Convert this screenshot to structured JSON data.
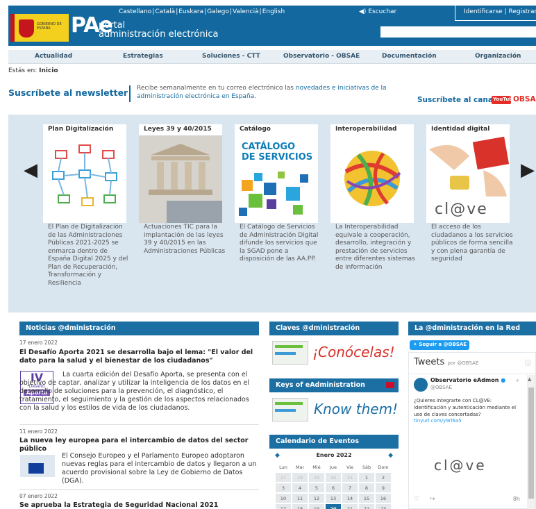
{
  "header": {
    "gov_label": "GOBIERNO DE ESPAÑA",
    "logo_pae": "PAe",
    "logo_line1": "portal",
    "logo_line2": "administración electrónica",
    "languages": [
      "Castellano",
      "Català",
      "Euskara",
      "Galego",
      "Valencià",
      "English"
    ],
    "listen": "Escuchar",
    "identify": "Identificarse",
    "register": "Registrarse",
    "search_placeholder": ""
  },
  "nav": [
    "Actualidad",
    "Estrategias",
    "Soluciones - CTT",
    "Observatorio - OBSAE",
    "Documentación",
    "Organización"
  ],
  "breadcrumb": {
    "prefix": "Estás en:",
    "current": "Inicio"
  },
  "newsletter": {
    "title": "Suscríbete al newsletter",
    "text_before": "Recibe semanalmente en tu correo electrónico las ",
    "text_link": "novedades e iniciativas de la administración electrónica en España",
    "text_after": ".",
    "channel": "Suscríbete al canal",
    "youtube": "YouTube",
    "obsae": "OBSAE"
  },
  "carousel": [
    {
      "title": "Plan Digitalización",
      "text": "El Plan de Digitalización de las Administraciones Públicas 2021-2025 se enmarca dentro de España Digital 2025 y del Plan de Recuperación, Transformación y Resiliencia"
    },
    {
      "title": "Leyes 39 y 40/2015",
      "text": "Actuaciones TIC para la implantación de las leyes 39 y 40/2015 en las Administraciones Públicas"
    },
    {
      "title": "Catálogo",
      "text": "El Catálogo de Servicios de Administración Digital difunde los servicios que la SGAD pone a disposición de las AA.PP.",
      "img_text1": "CATÁLOGO",
      "img_text2": "DE SERVICIOS"
    },
    {
      "title": "Interoperabilidad",
      "text": "La Interoperabilidad equivale a cooperación, desarrollo, integración y prestación de servicios entre diferentes sistemas de información"
    },
    {
      "title": "Identidad digital",
      "text": "El acceso de los ciudadanos a los servicios públicos de forma sencilla y con plena garantía de seguridad",
      "img_text": "cl@ve"
    }
  ],
  "news": {
    "header": "Noticias @dministración",
    "items": [
      {
        "date": "17 enero 2022",
        "title": "El Desafío Aporta 2021 se desarrolla bajo el lema: \"El valor del dato para la salud y el bienestar de los ciudadanos\"",
        "body": "La cuarta edición del Desafío Aporta, se presenta con el objetivo de captar, analizar y utilizar la inteligencia de los datos en el desarrollo de soluciones para la prevención, el diagnóstico, el tratamiento, el seguimiento y la gestión de los aspectos relacionados con la salud y los estilos de vida de los ciudadanos.",
        "thumb1": "IV",
        "thumb2": "Desafío",
        "thumb3": "Aporta"
      },
      {
        "date": "11 enero 2022",
        "title": "La nueva ley europea para el intercambio de datos del sector público",
        "body": "El Consejo Europeo y el Parlamento Europeo adoptaron nuevas reglas para el intercambio de datos y llegaron a un acuerdo provisional sobre la Ley de Gobierno de Datos (DGA)."
      },
      {
        "date": "07 enero 2022",
        "title": "Se aprueba la Estrategia de Seguridad Nacional 2021"
      }
    ]
  },
  "claves": {
    "header": "Claves @dministración",
    "banner": "¡Conócelas!"
  },
  "keys": {
    "header": "Keys of eAdministration",
    "banner": "Know them!"
  },
  "calendar": {
    "header": "Calendario de Eventos",
    "month": "Enero 2022",
    "days": [
      "Lun",
      "Mar",
      "Mié",
      "Jue",
      "Vie",
      "Sáb",
      "Dom"
    ],
    "weeks": [
      [
        "27",
        "28",
        "29",
        "30",
        "31",
        "1",
        "2"
      ],
      [
        "3",
        "4",
        "5",
        "6",
        "7",
        "8",
        "9"
      ],
      [
        "10",
        "11",
        "12",
        "13",
        "14",
        "15",
        "16"
      ],
      [
        "17",
        "18",
        "19",
        "20",
        "21",
        "22",
        "23"
      ]
    ],
    "selected": "20"
  },
  "social": {
    "header": "La @dministración en la Red",
    "follow": "Seguir a @OBSAE",
    "tweets": "Tweets",
    "by": "por @OBSAE",
    "account_name": "Observatorio eAdmon",
    "handle": "@OBSAE",
    "tweet_text": "¿Quieres integrarte con CL@VE: identificación y autenticación mediante el uso de claves concertadas?",
    "tweet_link": "tinyurl.com/y9rl6a5",
    "clave": "cl@ve",
    "time": "8h"
  },
  "colors": {
    "brand_blue": "#13699f",
    "bar_blue": "#1c6fa3",
    "gold": "#f4d01e",
    "red": "#c4161c"
  }
}
